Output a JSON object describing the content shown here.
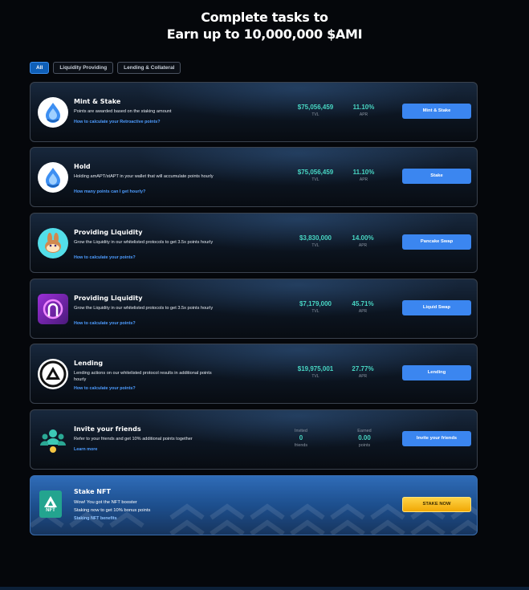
{
  "header": {
    "line1": "Complete tasks to",
    "line2": "Earn up to 10,000,000 $AMI"
  },
  "filters": [
    {
      "label": "All",
      "active": true
    },
    {
      "label": "Liquidity Providing",
      "active": false
    },
    {
      "label": "Lending & Collateral",
      "active": false
    }
  ],
  "tasks": [
    {
      "title": "Mint & Stake",
      "desc": "Points are awarded based on the staking amount",
      "link": "How to calculate your Retroactive points?",
      "tvl": "$75,056,459",
      "tvl_label": "TVL",
      "apr": "11.10%",
      "apr_label": "APR",
      "button": "Mint & Stake",
      "icon": "amnis-drop-icon"
    },
    {
      "title": "Hold",
      "desc": "Holding amAPT/stAPT in your wallet that will accumulate points hourly",
      "link": "How many points can I get hourly?",
      "tvl": "$75,056,459",
      "tvl_label": "TVL",
      "apr": "11.10%",
      "apr_label": "APR",
      "button": "Stake",
      "icon": "amnis-drop-icon"
    },
    {
      "title": "Providing Liquidity",
      "desc": "Grow the Liquidity in our whitelisted protocols to get 3.5x points hourly",
      "link": "How to calculate your points?",
      "tvl": "$3,830,000",
      "tvl_label": "TVL",
      "apr": "14.00%",
      "apr_label": "APR",
      "button": "Pancake Swap",
      "icon": "pancake-bunny-icon"
    },
    {
      "title": "Providing Liquidity",
      "desc": "Grow the Liquidity in our whitelisted protocols to get 3.5x points hourly",
      "link": "How to calculate your points?",
      "tvl": "$7,179,000",
      "tvl_label": "TVL",
      "apr": "45.71%",
      "apr_label": "APR",
      "button": "Liquid Swap",
      "icon": "liquidswap-icon"
    },
    {
      "title": "Lending",
      "desc": "Lending actions on our whitelisted protocol results in additional points hourly",
      "link": "How to calculate your points?",
      "tvl": "$19,975,001",
      "tvl_label": "TVL",
      "apr": "27.77%",
      "apr_label": "APR",
      "button": "Lending",
      "icon": "aries-triangle-icon"
    }
  ],
  "invite": {
    "title": "Invite your friends",
    "desc": "Refer to your friends and get 10% additional points together",
    "link": "Learn more",
    "invited_label": "Invited",
    "invited_value": "0",
    "invited_unit": "friends",
    "earned_label": "Earned",
    "earned_value": "0.00",
    "earned_unit": "points",
    "button": "Invite your friends"
  },
  "nft": {
    "title": "Stake NFT",
    "line1": "Wow! You got the NFT booster",
    "line2": "Staking now to get 10% bonus points",
    "link": "Staking NFT benefits",
    "button": "STAKE NOW",
    "badge": "NFT"
  },
  "colors": {
    "accent": "#3b86f0",
    "teal": "#48d6c3",
    "link": "#4d9cff",
    "gold": "#f5b50a"
  }
}
